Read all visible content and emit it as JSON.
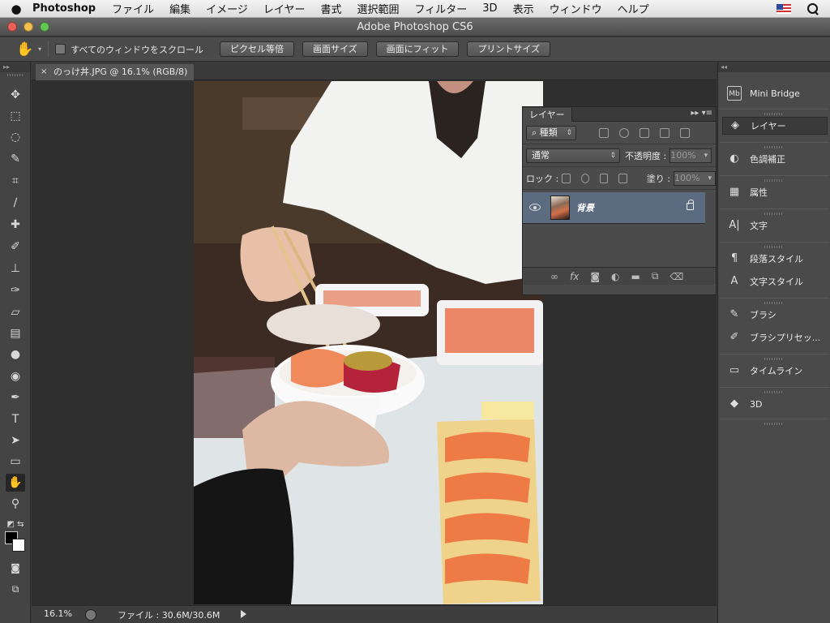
{
  "menubar": {
    "app": "Photoshop",
    "items": [
      "ファイル",
      "編集",
      "イメージ",
      "レイヤー",
      "書式",
      "選択範囲",
      "フィルター",
      "3D",
      "表示",
      "ウィンドウ",
      "ヘルプ"
    ]
  },
  "window": {
    "title": "Adobe Photoshop CS6",
    "lights": [
      "#ec5f57",
      "#f4be4f",
      "#62c655"
    ]
  },
  "options": {
    "scroll_all_label": "すべてのウィンドウをスクロール",
    "scroll_all_checked": false,
    "buttons": [
      "ピクセル等倍",
      "画面サイズ",
      "画面にフィット",
      "プリントサイズ"
    ]
  },
  "tools": [
    {
      "name": "move-icon",
      "glyph": "✥"
    },
    {
      "name": "marquee-icon",
      "glyph": "⬚"
    },
    {
      "name": "lasso-icon",
      "glyph": "◌"
    },
    {
      "name": "quick-select-icon",
      "glyph": "✎"
    },
    {
      "name": "crop-icon",
      "glyph": "⌗"
    },
    {
      "name": "eyedropper-icon",
      "glyph": "∕"
    },
    {
      "name": "healing-brush-icon",
      "glyph": "✚"
    },
    {
      "name": "brush-icon",
      "glyph": "✐"
    },
    {
      "name": "stamp-icon",
      "glyph": "⊥"
    },
    {
      "name": "history-brush-icon",
      "glyph": "✑"
    },
    {
      "name": "eraser-icon",
      "glyph": "▱"
    },
    {
      "name": "gradient-icon",
      "glyph": "▤"
    },
    {
      "name": "blur-icon",
      "glyph": "●"
    },
    {
      "name": "dodge-icon",
      "glyph": "◉"
    },
    {
      "name": "pen-icon",
      "glyph": "✒"
    },
    {
      "name": "type-icon",
      "glyph": "T"
    },
    {
      "name": "path-select-icon",
      "glyph": "➤"
    },
    {
      "name": "shape-icon",
      "glyph": "▭"
    },
    {
      "name": "hand-icon",
      "glyph": "✋",
      "active": true
    },
    {
      "name": "zoom-icon",
      "glyph": "⚲"
    }
  ],
  "document": {
    "tab_label": "のっけ丼.JPG @ 16.1% (RGB/8)",
    "zoom": "16.1%",
    "file_info": "ファイル : 30.6M/30.6M"
  },
  "layers_panel": {
    "tab": "レイヤー",
    "filter_label": "種類",
    "blend_mode": "通常",
    "opacity_label": "不透明度 :",
    "opacity_value": "100%",
    "lock_label": "ロック :",
    "fill_label": "塗り :",
    "fill_value": "100%",
    "layer_name": "背景"
  },
  "dock": [
    {
      "label": "Mini Bridge",
      "icon": "mini-bridge-icon",
      "glyph": "Mb"
    },
    {
      "label": "レイヤー",
      "icon": "layers-icon",
      "glyph": "◈",
      "active": true
    },
    {
      "label": "色調補正",
      "icon": "adjustments-icon",
      "glyph": "◐"
    },
    {
      "label": "属性",
      "icon": "properties-icon",
      "glyph": "▦"
    },
    {
      "label": "文字",
      "icon": "character-icon",
      "glyph": "A|"
    },
    {
      "label": "段落スタイル",
      "icon": "paragraph-styles-icon",
      "glyph": "¶"
    },
    {
      "label": "文字スタイル",
      "icon": "character-styles-icon",
      "glyph": "A"
    },
    {
      "label": "ブラシ",
      "icon": "brush-panel-icon",
      "glyph": "✎"
    },
    {
      "label": "ブラシプリセッ...",
      "icon": "brush-presets-icon",
      "glyph": "✐"
    },
    {
      "label": "タイムライン",
      "icon": "timeline-icon",
      "glyph": "▭"
    },
    {
      "label": "3D",
      "icon": "3d-icon",
      "glyph": "◆"
    }
  ]
}
